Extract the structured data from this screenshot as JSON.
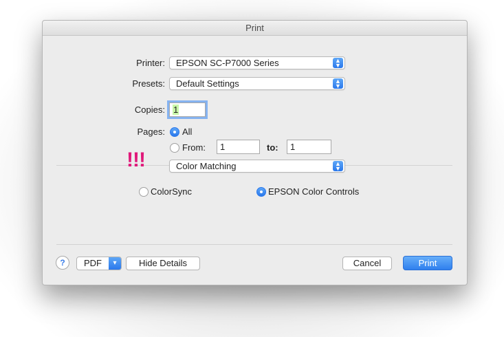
{
  "window": {
    "title": "Print"
  },
  "form": {
    "printer_label": "Printer:",
    "printer_value": "EPSON SC-P7000 Series",
    "presets_label": "Presets:",
    "presets_value": "Default Settings",
    "copies_label": "Copies:",
    "copies_value": "1",
    "pages_label": "Pages:",
    "pages_all_label": "All",
    "pages_from_label": "From:",
    "pages_from_value": "1",
    "pages_to_label": "to:",
    "pages_to_value": "1",
    "pages_selected": "All"
  },
  "annotation": {
    "text": "!!!",
    "color": "#e0197a"
  },
  "panel": {
    "selected_panel": "Color Matching",
    "options": [
      {
        "label": "ColorSync",
        "selected": false
      },
      {
        "label": "EPSON Color Controls",
        "selected": true
      }
    ]
  },
  "footer": {
    "help_label": "?",
    "pdf_label": "PDF",
    "hide_details_label": "Hide Details",
    "cancel_label": "Cancel",
    "print_label": "Print"
  },
  "colors": {
    "accent": "#2f7fee"
  }
}
